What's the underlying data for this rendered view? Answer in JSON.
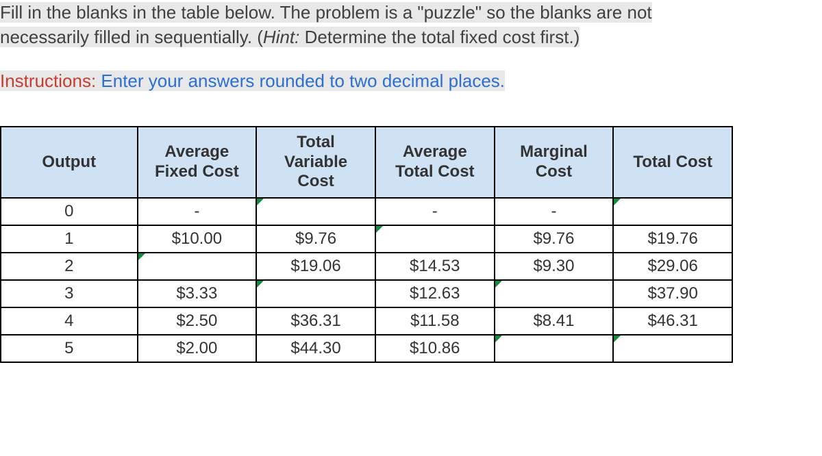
{
  "problem": {
    "line_a": "Fill in the blanks in the table below. The problem is a \"puzzle\" so the blanks are not",
    "line_b_prefix": "necessarily filled in sequentially. (",
    "hint_label": "Hint:",
    "hint_text": " Determine the total fixed cost first.)"
  },
  "instructions": {
    "label": "Instructions:",
    "text": " Enter your answers rounded to two decimal places."
  },
  "headers": {
    "output": "Output",
    "afc": "Average Fixed Cost",
    "tvc": "Total Variable Cost",
    "atc": "Average Total Cost",
    "mc": "Marginal Cost",
    "tc": "Total Cost"
  },
  "rows": [
    {
      "output": "0",
      "afc": "-",
      "tvc": "",
      "atc": "-",
      "mc": "-",
      "tc": "",
      "edit": [
        "tvc",
        "tc"
      ]
    },
    {
      "output": "1",
      "afc": "$10.00",
      "tvc": "$9.76",
      "atc": "",
      "mc": "$9.76",
      "tc": "$19.76",
      "edit": [
        "atc"
      ]
    },
    {
      "output": "2",
      "afc": "",
      "tvc": "$19.06",
      "atc": "$14.53",
      "mc": "$9.30",
      "tc": "$29.06",
      "edit": [
        "afc"
      ]
    },
    {
      "output": "3",
      "afc": "$3.33",
      "tvc": "",
      "atc": "$12.63",
      "mc": "",
      "tc": "$37.90",
      "edit": [
        "tvc",
        "mc"
      ]
    },
    {
      "output": "4",
      "afc": "$2.50",
      "tvc": "$36.31",
      "atc": "$11.58",
      "mc": "$8.41",
      "tc": "$46.31",
      "edit": []
    },
    {
      "output": "5",
      "afc": "$2.00",
      "tvc": "$44.30",
      "atc": "$10.86",
      "mc": "",
      "tc": "",
      "edit": [
        "mc",
        "tc"
      ]
    }
  ]
}
